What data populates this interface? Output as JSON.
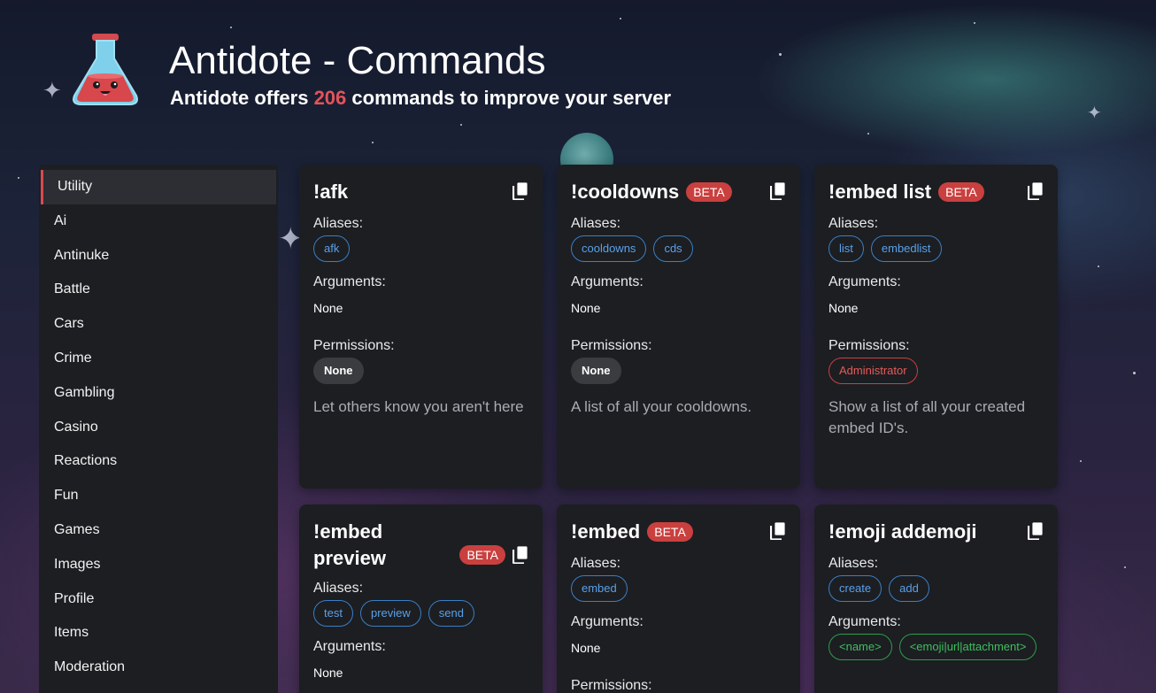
{
  "header": {
    "title": "Antidote - Commands",
    "subtitle_pre": "Antidote offers ",
    "subtitle_count": "206",
    "subtitle_post": " commands to improve your server"
  },
  "sidebar": {
    "items": [
      {
        "label": "Utility",
        "active": true
      },
      {
        "label": "Ai"
      },
      {
        "label": "Antinuke"
      },
      {
        "label": "Battle"
      },
      {
        "label": "Cars"
      },
      {
        "label": "Crime"
      },
      {
        "label": "Gambling"
      },
      {
        "label": "Casino"
      },
      {
        "label": "Reactions"
      },
      {
        "label": "Fun"
      },
      {
        "label": "Games"
      },
      {
        "label": "Images"
      },
      {
        "label": "Profile"
      },
      {
        "label": "Items"
      },
      {
        "label": "Moderation"
      }
    ]
  },
  "labels": {
    "aliases": "Aliases:",
    "arguments": "Arguments:",
    "permissions": "Permissions:",
    "beta": "BETA",
    "none": "None"
  },
  "cards": [
    {
      "name": "!afk",
      "aliases": [
        "afk"
      ],
      "arguments": "None",
      "permission": "None",
      "description": "Let others know you aren't here"
    },
    {
      "name": "!cooldowns",
      "aliases": [
        "cooldowns",
        "cds"
      ],
      "arguments": "None",
      "permission": "None",
      "description": "A list of all your cooldowns."
    },
    {
      "name": "!embed list",
      "aliases": [
        "list",
        "embedlist"
      ],
      "arguments": "None",
      "permission": "Administrator",
      "description": "Show a list of all your created embed ID's."
    },
    {
      "name": "!embed preview",
      "aliases": [
        "test",
        "preview",
        "send"
      ],
      "arguments": "None"
    },
    {
      "name": "!embed",
      "aliases": [
        "embed"
      ],
      "arguments": "None",
      "permissions_label": "Permissions:"
    },
    {
      "name": "!emoji addemoji",
      "aliases": [
        "create",
        "add"
      ],
      "arguments_list": [
        "<name>",
        "<emoji|url|attachment>"
      ]
    }
  ],
  "colors": {
    "accent_red": "#d84a50",
    "alias_blue": "#5aa0e8",
    "arg_green": "#3fbf5f",
    "card_bg": "#1c1e22"
  },
  "icons": {
    "copy": "copy-icon",
    "logo": "flask-logo"
  }
}
